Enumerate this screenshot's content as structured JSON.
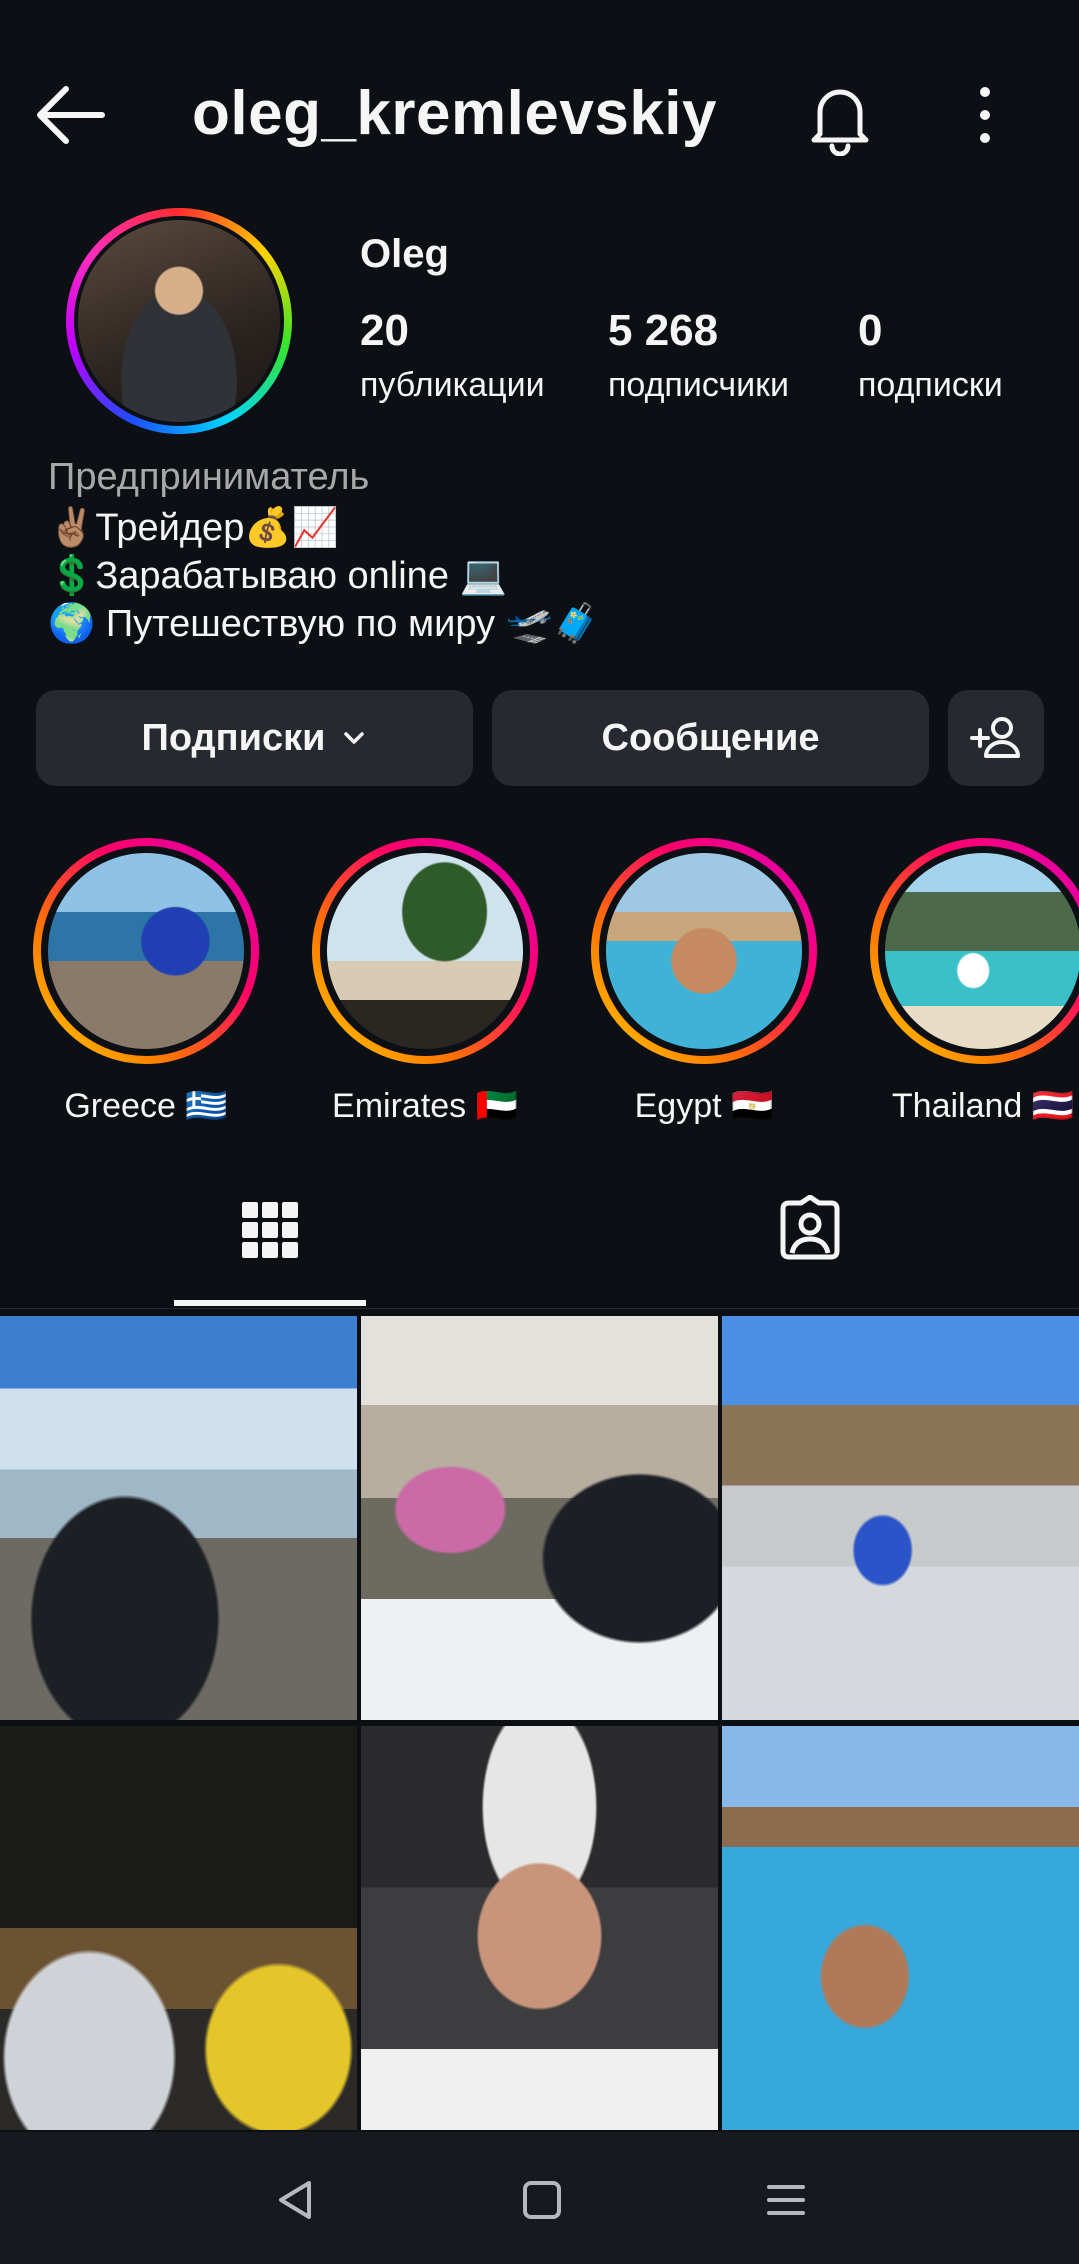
{
  "header": {
    "username": "oleg_kremlevskiy"
  },
  "profile": {
    "display_name": "Oleg",
    "stats": [
      {
        "value": "20",
        "label": "публикации"
      },
      {
        "value": "5 268",
        "label": "подписчики"
      },
      {
        "value": "0",
        "label": "подписки"
      }
    ],
    "bio": {
      "category": "Предприниматель",
      "lines": [
        "✌🏽Трейдер💰📈",
        "💲Зарабатываю online 💻",
        "🌍 Путешествую по миру 🛫🧳"
      ]
    }
  },
  "actions": {
    "follow_label": "Подписки",
    "message_label": "Сообщение"
  },
  "highlights": [
    {
      "label": "Greece 🇬🇷"
    },
    {
      "label": "Emirates 🇦🇪"
    },
    {
      "label": "Egypt 🇪🇬"
    },
    {
      "label": "Thailand 🇹🇭"
    }
  ],
  "icons": {
    "back": "arrow-left-icon",
    "notifications": "bell-icon",
    "more": "more-vertical-icon",
    "add_user": "add-user-icon",
    "grid_tab": "grid-icon",
    "tagged_tab": "tagged-person-icon",
    "nav": [
      "back-triangle-icon",
      "home-square-icon",
      "recents-menu-icon"
    ]
  },
  "colors": {
    "background": "#0c1014",
    "button": "#262a30",
    "muted_text": "#a8a8a8"
  }
}
